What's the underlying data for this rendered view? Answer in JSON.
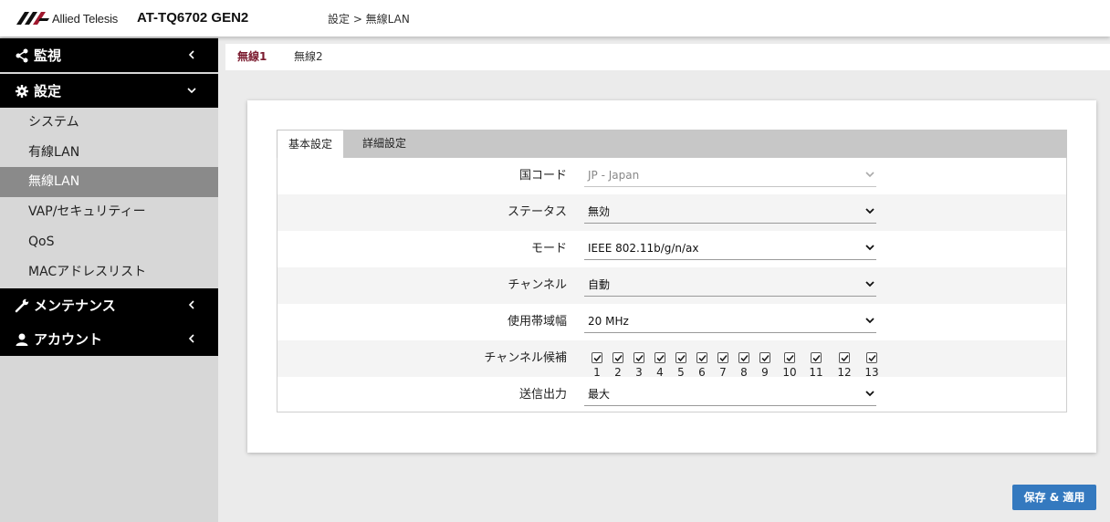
{
  "header": {
    "brand": "Allied Telesis",
    "device": "AT-TQ6702 GEN2",
    "breadcrumb": "設定 > 無線LAN"
  },
  "sidebar": {
    "groups": [
      {
        "label": "監視",
        "icon": "share-icon",
        "state": "collapsed"
      },
      {
        "label": "設定",
        "icon": "gear-icon",
        "state": "expanded"
      },
      {
        "label": "メンテナンス",
        "icon": "wrench-icon",
        "state": "collapsed"
      },
      {
        "label": "アカウント",
        "icon": "user-icon",
        "state": "collapsed"
      }
    ],
    "items": [
      {
        "label": "システム"
      },
      {
        "label": "有線LAN"
      },
      {
        "label": "無線LAN",
        "active": true
      },
      {
        "label": "VAP/セキュリティー"
      },
      {
        "label": "QoS"
      },
      {
        "label": "MACアドレスリスト"
      }
    ]
  },
  "main_tabs": [
    {
      "label": "無線1",
      "active": true
    },
    {
      "label": "無線2",
      "active": false
    }
  ],
  "inner_tabs": [
    {
      "label": "基本設定",
      "active": true
    },
    {
      "label": "詳細設定",
      "active": false
    }
  ],
  "form": {
    "country": {
      "label": "国コード",
      "value": "JP - Japan",
      "disabled": true
    },
    "status": {
      "label": "ステータス",
      "value": "無効"
    },
    "mode": {
      "label": "モード",
      "value": "IEEE 802.11b/g/n/ax"
    },
    "channel": {
      "label": "チャンネル",
      "value": "自動"
    },
    "bandwidth": {
      "label": "使用帯域幅",
      "value": "20 MHz"
    },
    "channel_candidates": {
      "label": "チャンネル候補",
      "channels": [
        "1",
        "2",
        "3",
        "4",
        "5",
        "6",
        "7",
        "8",
        "9",
        "10",
        "11",
        "12",
        "13"
      ],
      "checked": [
        true,
        true,
        true,
        true,
        true,
        true,
        true,
        true,
        true,
        true,
        true,
        true,
        true
      ]
    },
    "tx_power": {
      "label": "送信出力",
      "value": "最大"
    }
  },
  "buttons": {
    "save_apply": "保存 & 適用"
  },
  "colors": {
    "accent": "#3479bf",
    "active_tab": "#7a1a2e",
    "sidebar_dark": "#000000",
    "sidebar_active": "#8a8a8a"
  }
}
